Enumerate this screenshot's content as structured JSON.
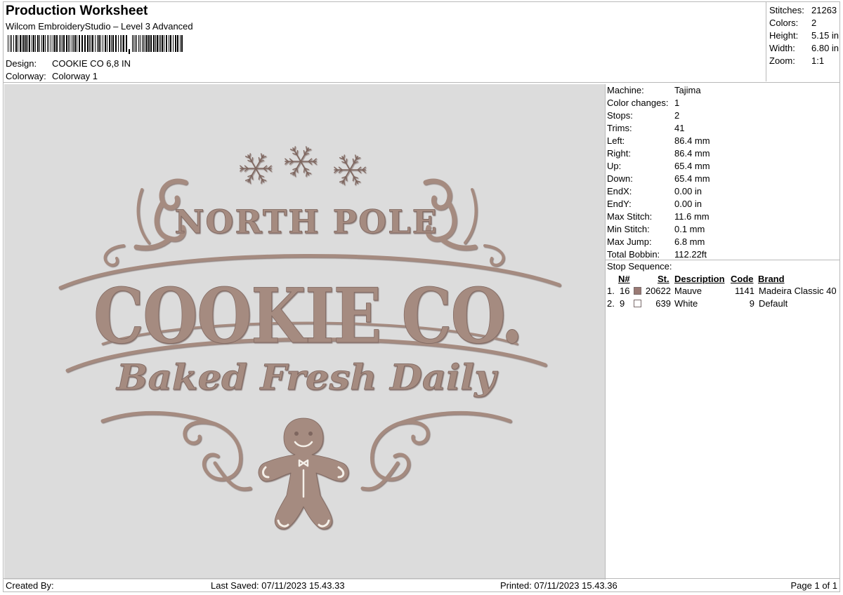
{
  "header": {
    "title": "Production Worksheet",
    "software": "Wilcom EmbroideryStudio – Level 3 Advanced",
    "design_label": "Design:",
    "design_value": "COOKIE CO 6,8 IN",
    "colorway_label": "Colorway:",
    "colorway_value": "Colorway 1"
  },
  "summary": [
    {
      "label": "Stitches:",
      "value": "21263"
    },
    {
      "label": "Colors:",
      "value": "2"
    },
    {
      "label": "Height:",
      "value": "5.15 in"
    },
    {
      "label": "Width:",
      "value": "6.80 in"
    },
    {
      "label": "Zoom:",
      "value": "1:1"
    }
  ],
  "machine_info": [
    {
      "label": "Machine:",
      "value": "Tajima"
    },
    {
      "label": "Color changes:",
      "value": "1"
    },
    {
      "label": "Stops:",
      "value": "2"
    },
    {
      "label": "Trims:",
      "value": "41"
    },
    {
      "label": "Left:",
      "value": "86.4 mm"
    },
    {
      "label": "Right:",
      "value": "86.4 mm"
    },
    {
      "label": "Up:",
      "value": "65.4 mm"
    },
    {
      "label": "Down:",
      "value": "65.4 mm"
    },
    {
      "label": "EndX:",
      "value": "0.00 in"
    },
    {
      "label": "EndY:",
      "value": "0.00 in"
    },
    {
      "label": "Max Stitch:",
      "value": "11.6 mm"
    },
    {
      "label": "Min Stitch:",
      "value": "0.1 mm"
    },
    {
      "label": "Max Jump:",
      "value": "6.8 mm"
    },
    {
      "label": "Total Bobbin:",
      "value": "112.22ft"
    }
  ],
  "stop_sequence": {
    "title": "Stop Sequence:",
    "columns": {
      "n": "N#",
      "st": "St.",
      "description": "Description",
      "code": "Code",
      "brand": "Brand"
    },
    "rows": [
      {
        "index": "1.",
        "n": "16",
        "color": "#9a7a74",
        "st": "20622",
        "description": "Mauve",
        "code": "1141",
        "brand": "Madeira Classic 40"
      },
      {
        "index": "2.",
        "n": "9",
        "color": "#ffffff",
        "st": "639",
        "description": "White",
        "code": "9",
        "brand": "Default"
      }
    ]
  },
  "design": {
    "line1": "NORTH POLE",
    "line2": "COOKIE CO.",
    "line3": "Baked Fresh Daily",
    "thread_color": "#a58b80",
    "thread_dark": "#7e665e",
    "highlight_color": "#f4efe8",
    "background": "#dcdcdc"
  },
  "footer": {
    "created_by": "Created By:",
    "last_saved": "Last Saved: 07/11/2023 15.43.33",
    "printed": "Printed: 07/11/2023 15.43.36",
    "page": "Page 1 of 1"
  }
}
